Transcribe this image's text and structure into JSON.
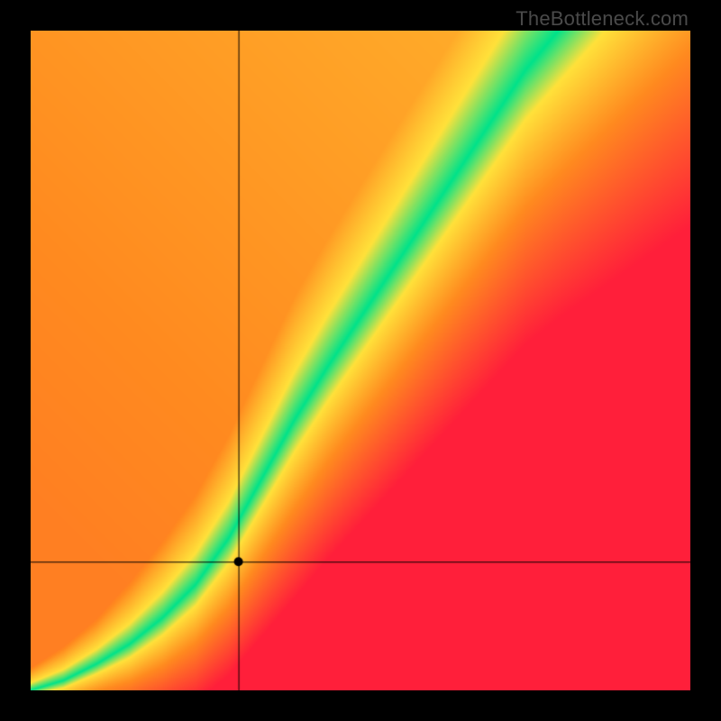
{
  "watermark": "TheBottleneck.com",
  "chart_data": {
    "type": "heatmap",
    "title": "",
    "xlabel": "",
    "ylabel": "",
    "xlim": [
      0,
      1
    ],
    "ylim": [
      0,
      1
    ],
    "crosshair": {
      "x": 0.315,
      "y": 0.195
    },
    "marker": {
      "x": 0.315,
      "y": 0.195
    },
    "ridge": [
      {
        "x": 0.0,
        "y": 0.0
      },
      {
        "x": 0.05,
        "y": 0.015
      },
      {
        "x": 0.1,
        "y": 0.04
      },
      {
        "x": 0.15,
        "y": 0.07
      },
      {
        "x": 0.2,
        "y": 0.11
      },
      {
        "x": 0.25,
        "y": 0.16
      },
      {
        "x": 0.3,
        "y": 0.23
      },
      {
        "x": 0.35,
        "y": 0.32
      },
      {
        "x": 0.4,
        "y": 0.41
      },
      {
        "x": 0.45,
        "y": 0.49
      },
      {
        "x": 0.5,
        "y": 0.565
      },
      {
        "x": 0.55,
        "y": 0.64
      },
      {
        "x": 0.6,
        "y": 0.715
      },
      {
        "x": 0.65,
        "y": 0.79
      },
      {
        "x": 0.7,
        "y": 0.865
      },
      {
        "x": 0.75,
        "y": 0.94
      },
      {
        "x": 0.8,
        "y": 1.0
      }
    ],
    "ridge_width": [
      {
        "x": 0.0,
        "w": 0.01
      },
      {
        "x": 0.1,
        "w": 0.02
      },
      {
        "x": 0.2,
        "w": 0.035
      },
      {
        "x": 0.3,
        "w": 0.05
      },
      {
        "x": 0.4,
        "w": 0.065
      },
      {
        "x": 0.5,
        "w": 0.075
      },
      {
        "x": 0.6,
        "w": 0.085
      },
      {
        "x": 0.7,
        "w": 0.095
      },
      {
        "x": 0.8,
        "w": 0.105
      }
    ],
    "palette": {
      "green": "#00e28a",
      "yellow": "#ffe13a",
      "orange": "#ff8a1f",
      "red": "#ff1f3a"
    }
  }
}
